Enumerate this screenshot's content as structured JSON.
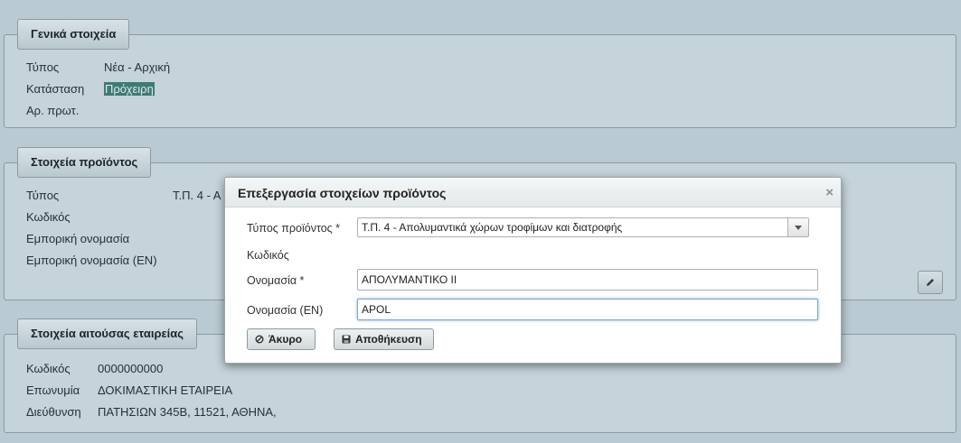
{
  "general": {
    "title": "Γενικά στοιχεία",
    "type_label": "Τύπος",
    "type_value": "Νέα - Αρχική",
    "status_label": "Κατάσταση",
    "status_value": "Πρόχειρη",
    "protocol_label": "Αρ. πρωτ."
  },
  "product": {
    "title": "Στοιχεία προϊόντος",
    "type_label": "Τύπος",
    "type_value_partial": "Τ.Π. 4 - Α",
    "code_label": "Κωδικός",
    "trade_name_label": "Εμπορική ονομασία",
    "trade_name_en_label": "Εμπορική ονομασία (EN)"
  },
  "company": {
    "title": "Στοιχεία αιτούσας εταιρείας",
    "code_label": "Κωδικός",
    "code_value": "0000000000",
    "name_label": "Επωνυμία",
    "name_value": "ΔΟΚΙΜΑΣΤΙΚΗ ΕΤΑΙΡΕΙΑ",
    "address_label": "Διεύθυνση",
    "address_value": "ΠΑΤΗΣΙΩΝ 345Β, 11521, ΑΘΗΝΑ,"
  },
  "modal": {
    "title": "Επεξεργασία στοιχείων προϊόντος",
    "close_glyph": "×",
    "product_type_label": "Τύπος προϊόντος  *",
    "product_type_value": "Τ.Π. 4 - Απολυμαντικά χώρων τροφίμων και διατροφής",
    "code_label": "Κωδικός",
    "name_label": "Ονομασία  *",
    "name_value": "ΑΠΟΛΥΜΑΝΤΙΚΟ ΙΙ",
    "name_en_label": "Ονομασία (EN)",
    "name_en_value": "APOL",
    "cancel_label": "Άκυρο",
    "save_label": "Αποθήκευση"
  },
  "icons": {
    "cancel": "cancel-circle-icon",
    "save": "floppy-disk-icon",
    "edit": "pencil-icon",
    "dropdown": "chevron-down-icon"
  },
  "colors": {
    "status_badge_bg": "#3f7a74",
    "page_bg": "#b9cad3"
  }
}
